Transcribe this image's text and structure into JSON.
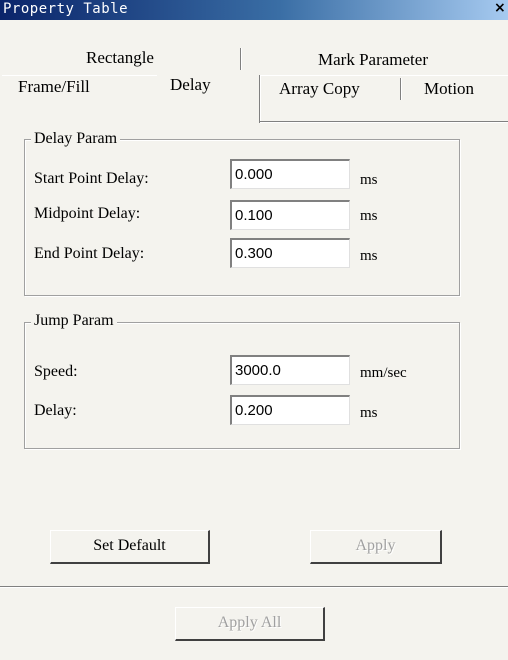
{
  "window": {
    "title": "Property Table"
  },
  "tabs": {
    "row1": [
      "Rectangle",
      "Mark Parameter"
    ],
    "row2": [
      "Frame/Fill",
      "Delay",
      "Array Copy",
      "Motion"
    ]
  },
  "delay_param": {
    "legend": "Delay Param",
    "fields": [
      {
        "label": "Start Point Delay:",
        "value": "0.000",
        "unit": "ms"
      },
      {
        "label": "Midpoint Delay:",
        "value": "0.100",
        "unit": "ms"
      },
      {
        "label": "End Point Delay:",
        "value": "0.300",
        "unit": "ms"
      }
    ]
  },
  "jump_param": {
    "legend": "Jump Param",
    "fields": [
      {
        "label": "Speed:",
        "value": "3000.0",
        "unit": "mm/sec"
      },
      {
        "label": "Delay:",
        "value": "0.200",
        "unit": "ms"
      }
    ]
  },
  "buttons": {
    "set_default": "Set Default",
    "apply": "Apply",
    "apply_all": "Apply All"
  }
}
